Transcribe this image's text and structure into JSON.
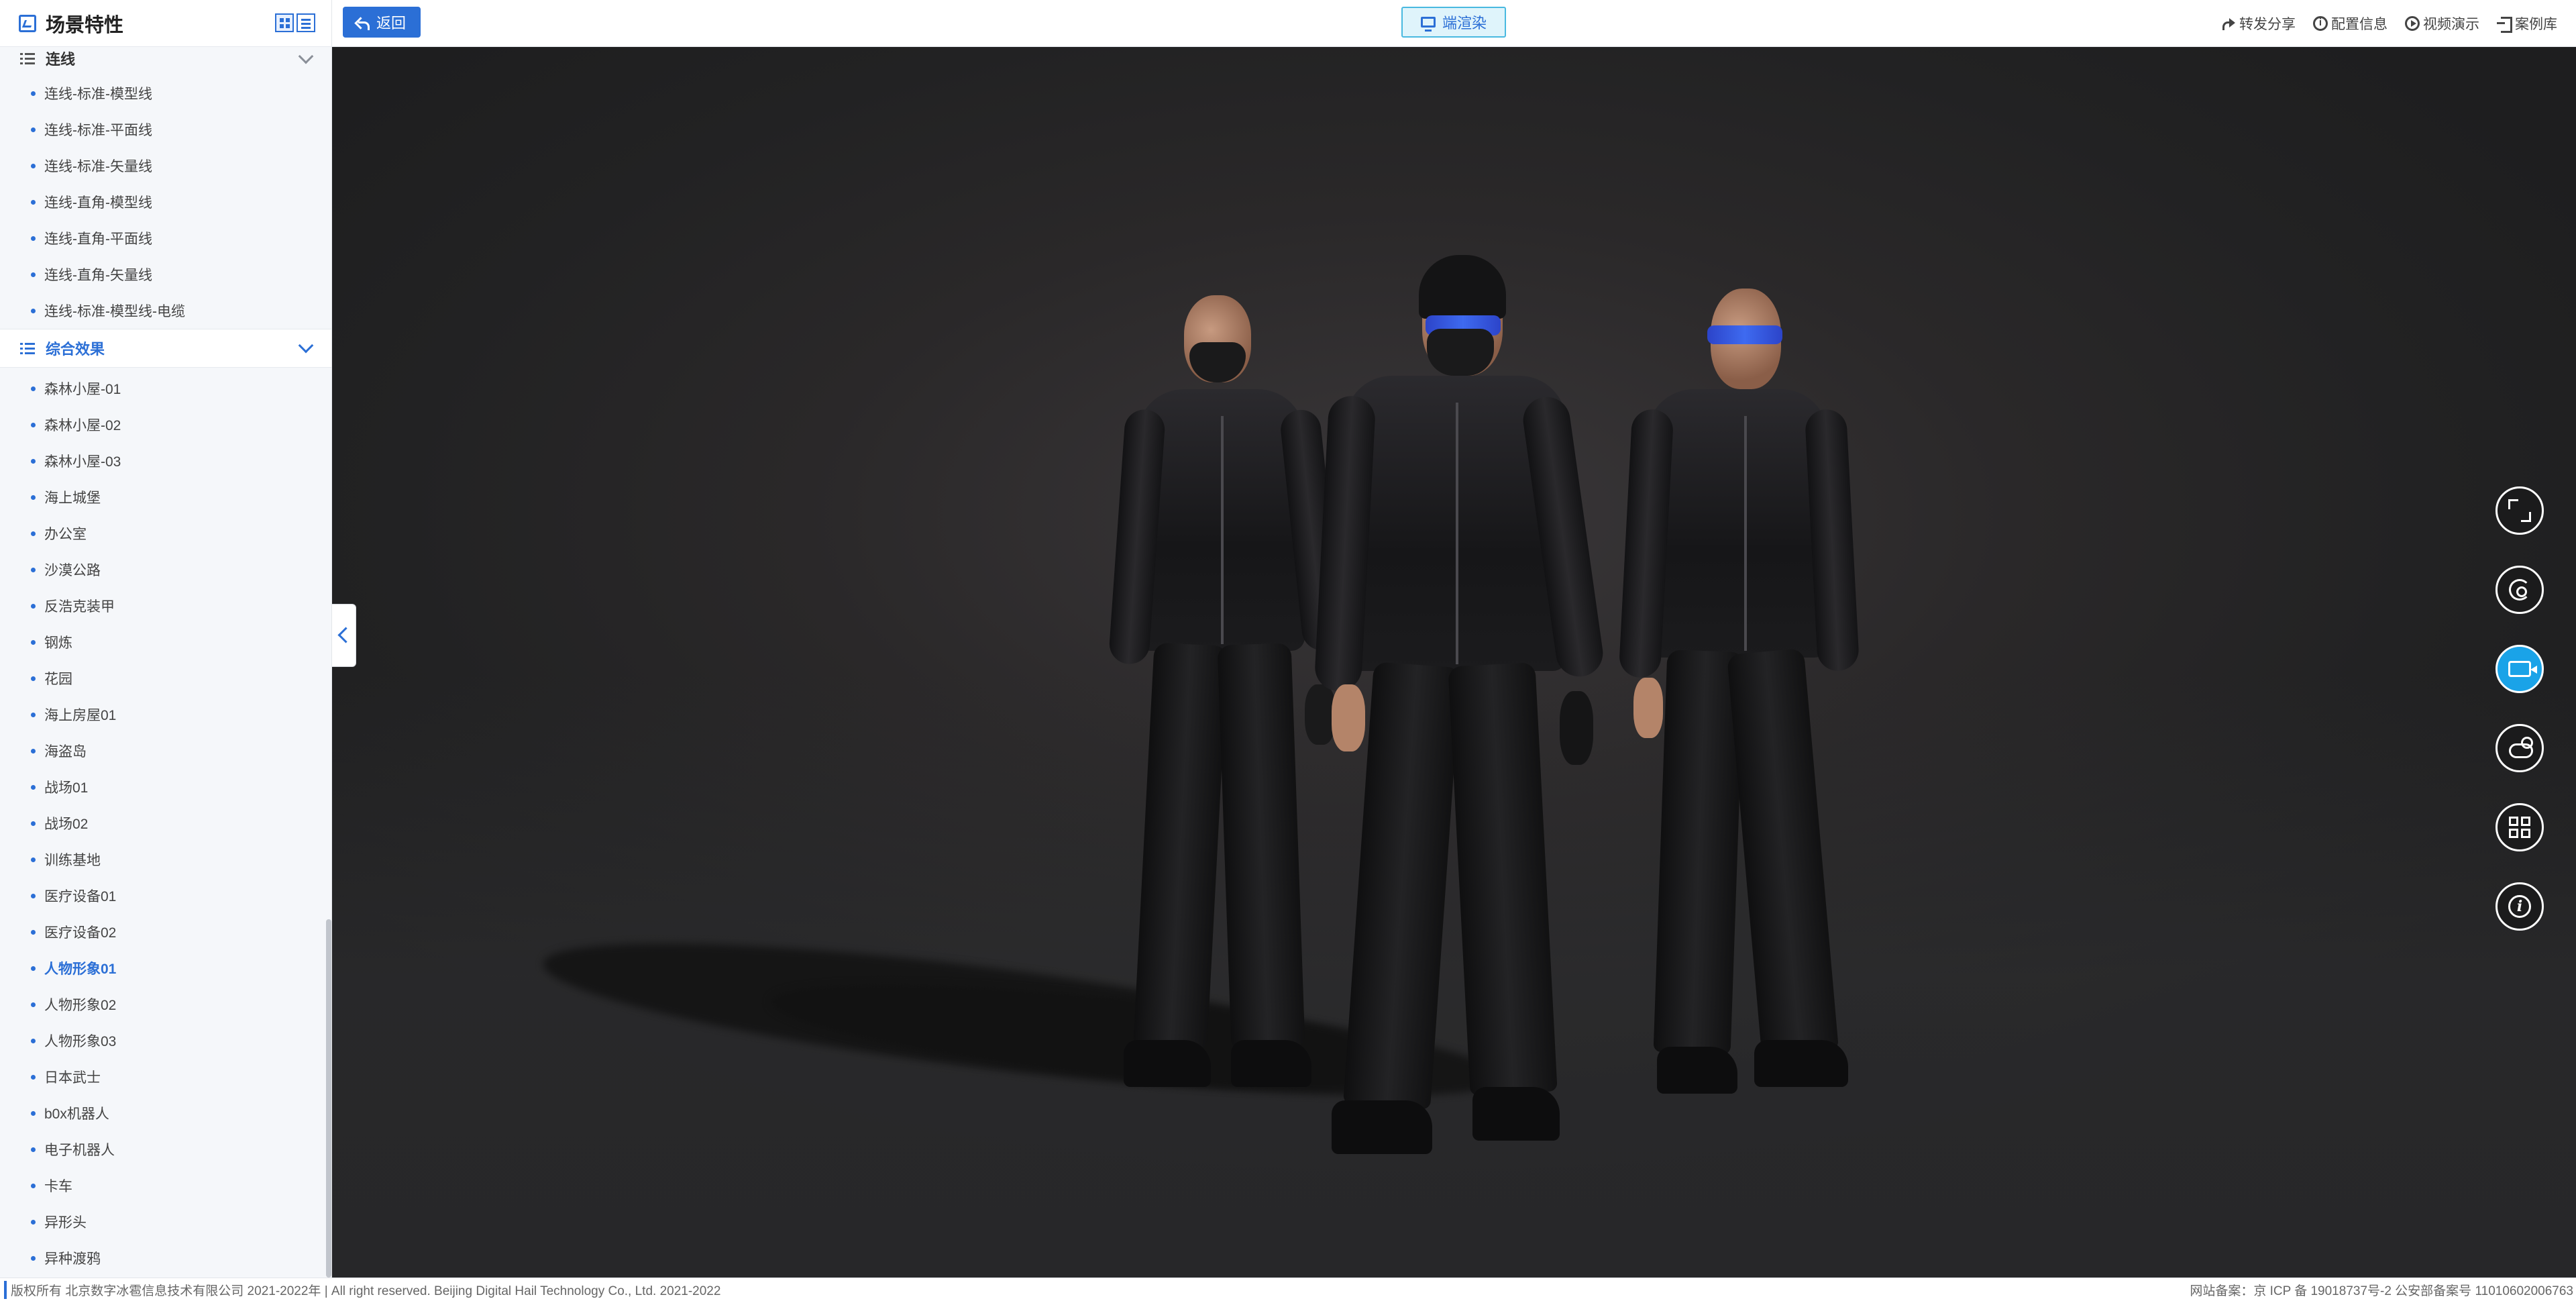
{
  "sidebar": {
    "title": "场景特性",
    "groups": [
      {
        "label": "连线",
        "items": [
          "连线-标准-模型线",
          "连线-标准-平面线",
          "连线-标准-矢量线",
          "连线-直角-模型线",
          "连线-直角-平面线",
          "连线-直角-矢量线",
          "连线-标准-模型线-电缆"
        ]
      },
      {
        "label": "综合效果",
        "items": [
          "森林小屋-01",
          "森林小屋-02",
          "森林小屋-03",
          "海上城堡",
          "办公室",
          "沙漠公路",
          "反浩克装甲",
          "钢炼",
          "花园",
          "海上房屋01",
          "海盗岛",
          "战场01",
          "战场02",
          "训练基地",
          "医疗设备01",
          "医疗设备02",
          "人物形象01",
          "人物形象02",
          "人物形象03",
          "日本武士",
          "b0x机器人",
          "电子机器人",
          "卡车",
          "异形头",
          "异种渡鸦"
        ],
        "active_item": "人物形象01"
      }
    ]
  },
  "topbar": {
    "back_label": "返回",
    "render_label": "端渲染",
    "links": [
      "转发分享",
      "配置信息",
      "视频演示",
      "案例库"
    ]
  },
  "tools": [
    "expand-icon",
    "rotate-icon",
    "camera-icon",
    "weather-icon",
    "grid-icon",
    "info-icon"
  ],
  "colors": {
    "accent": "#2b6fd6",
    "tool_active": "#1aa3e8",
    "viewport_bg": "#2a2829"
  },
  "footer": {
    "left": "版权所有 北京数字冰雹信息技术有限公司 2021-2022年 | All right reserved. Beijing Digital Hail Technology Co., Ltd. 2021-2022",
    "right": "网站备案：京 ICP 备 19018737号-2 公安部备案号 11010602006763"
  }
}
